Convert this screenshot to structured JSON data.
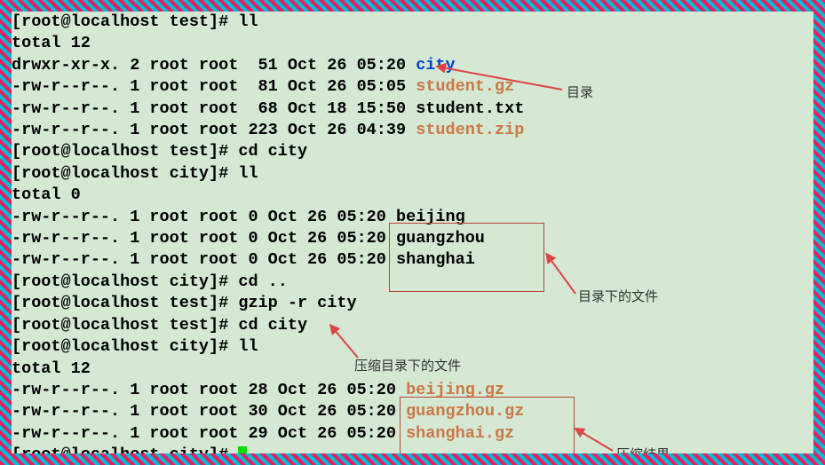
{
  "lines": [
    {
      "prompt": "[root@localhost test]# ",
      "cmd": "ll"
    },
    {
      "text": "total 12"
    },
    {
      "text": "drwxr-xr-x. 2 root root  51 Oct 26 05:20 ",
      "fname": "city",
      "fclass": "dir-blue"
    },
    {
      "text": "-rw-r--r--. 1 root root  81 Oct 26 05:05 ",
      "fname": "student.gz",
      "fclass": "gz-orange"
    },
    {
      "text": "-rw-r--r--. 1 root root  68 Oct 18 15:50 ",
      "fname": "student.txt",
      "fclass": "txt-black"
    },
    {
      "text": "-rw-r--r--. 1 root root 223 Oct 26 04:39 ",
      "fname": "student.zip",
      "fclass": "gz-orange"
    },
    {
      "prompt": "[root@localhost test]# ",
      "cmd": "cd city"
    },
    {
      "prompt": "[root@localhost city]# ",
      "cmd": "ll"
    },
    {
      "text": "total 0"
    },
    {
      "text": "-rw-r--r--. 1 root root 0 Oct 26 05:20 ",
      "fname": "beijing",
      "fclass": "txt-black"
    },
    {
      "text": "-rw-r--r--. 1 root root 0 Oct 26 05:20 ",
      "fname": "guangzhou",
      "fclass": "txt-black"
    },
    {
      "text": "-rw-r--r--. 1 root root 0 Oct 26 05:20 ",
      "fname": "shanghai",
      "fclass": "txt-black"
    },
    {
      "prompt": "[root@localhost city]# ",
      "cmd": "cd .."
    },
    {
      "prompt": "[root@localhost test]# ",
      "cmd": "gzip -r city"
    },
    {
      "prompt": "[root@localhost test]# ",
      "cmd": "cd city"
    },
    {
      "prompt": "[root@localhost city]# ",
      "cmd": "ll"
    },
    {
      "text": "total 12"
    },
    {
      "text": "-rw-r--r--. 1 root root 28 Oct 26 05:20 ",
      "fname": "beijing.gz",
      "fclass": "gz-orange"
    },
    {
      "text": "-rw-r--r--. 1 root root 30 Oct 26 05:20 ",
      "fname": "guangzhou.gz",
      "fclass": "gz-orange"
    },
    {
      "text": "-rw-r--r--. 1 root root 29 Oct 26 05:20 ",
      "fname": "shanghai.gz",
      "fclass": "gz-orange"
    },
    {
      "prompt": "[root@localhost city]# ",
      "cursor": true
    }
  ],
  "annotations": {
    "a1": "目录",
    "a2": "目录下的文件",
    "a3": "压缩目录下的文件",
    "a4": "压缩结果"
  }
}
